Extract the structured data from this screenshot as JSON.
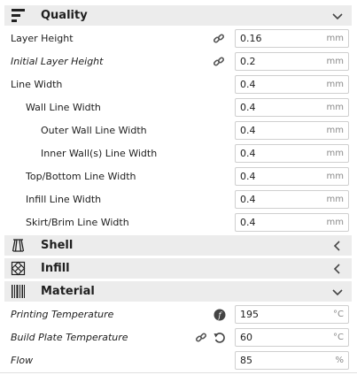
{
  "categories": {
    "quality": {
      "label": "Quality",
      "icon": "quality-bars-icon",
      "state": "expanded"
    },
    "shell": {
      "label": "Shell",
      "icon": "shell-icon",
      "state": "collapsed"
    },
    "infill": {
      "label": "Infill",
      "icon": "infill-icon",
      "state": "collapsed"
    },
    "material": {
      "label": "Material",
      "icon": "material-icon",
      "state": "expanded"
    }
  },
  "quality_settings": [
    {
      "label": "Layer Height",
      "value": "0.16",
      "unit": "mm"
    },
    {
      "label": "Initial Layer Height",
      "value": "0.2",
      "unit": "mm"
    },
    {
      "label": "Line Width",
      "value": "0.4",
      "unit": "mm"
    },
    {
      "label": "Wall Line Width",
      "value": "0.4",
      "unit": "mm"
    },
    {
      "label": "Outer Wall Line Width",
      "value": "0.4",
      "unit": "mm"
    },
    {
      "label": "Inner Wall(s) Line Width",
      "value": "0.4",
      "unit": "mm"
    },
    {
      "label": "Top/Bottom Line Width",
      "value": "0.4",
      "unit": "mm"
    },
    {
      "label": "Infill Line Width",
      "value": "0.4",
      "unit": "mm"
    },
    {
      "label": "Skirt/Brim Line Width",
      "value": "0.4",
      "unit": "mm"
    }
  ],
  "material_settings": [
    {
      "label": "Printing Temperature",
      "value": "195",
      "unit": "°C"
    },
    {
      "label": "Build Plate Temperature",
      "value": "60",
      "unit": "°C"
    },
    {
      "label": "Flow",
      "value": "85",
      "unit": "%"
    }
  ],
  "icons": {
    "link": "link-icon",
    "function": "function-icon",
    "reset": "reset-icon",
    "expand": "chevron-down-icon",
    "collapse": "chevron-left-icon"
  }
}
